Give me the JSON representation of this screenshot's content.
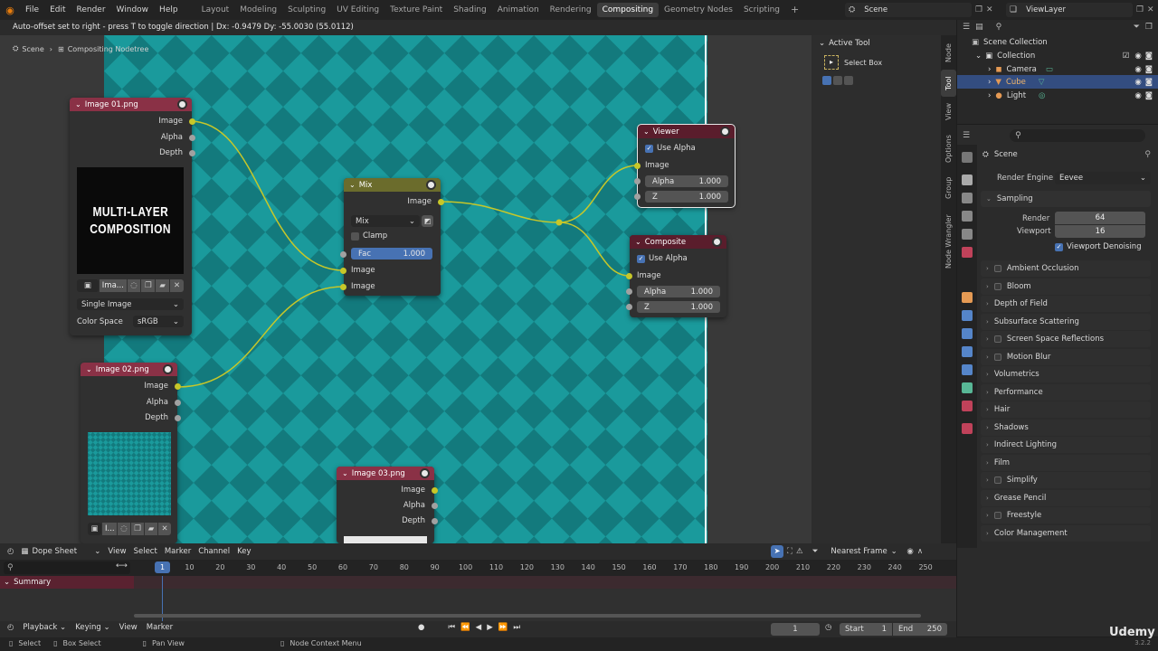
{
  "menus": [
    "File",
    "Edit",
    "Render",
    "Window",
    "Help"
  ],
  "workspaces": [
    "Layout",
    "Modeling",
    "Sculpting",
    "UV Editing",
    "Texture Paint",
    "Shading",
    "Animation",
    "Rendering",
    "Compositing",
    "Geometry Nodes",
    "Scripting"
  ],
  "active_workspace": "Compositing",
  "add_workspace": "+",
  "scene_name": "Scene",
  "view_layer": "ViewLayer",
  "status_header": "Auto-offset set to right - press T to toggle direction  |  Dx: -0.9479   Dy: -55.0030 (55.0112)",
  "breadcrumb": {
    "scene": "Scene",
    "tree": "Compositing Nodetree"
  },
  "nodes": {
    "image1": {
      "title": "Image 01.png",
      "outputs": [
        "Image",
        "Alpha",
        "Depth"
      ],
      "preview_line1": "MULTI-LAYER",
      "preview_line2": "COMPOSITION",
      "file_label": "Ima...",
      "source": "Single Image",
      "colorspace_label": "Color Space",
      "colorspace_value": "sRGB"
    },
    "image2": {
      "title": "Image 02.png",
      "outputs": [
        "Image",
        "Alpha",
        "Depth"
      ],
      "file_label": "I..."
    },
    "image3": {
      "title": "Image 03.png",
      "outputs": [
        "Image",
        "Alpha",
        "Depth"
      ]
    },
    "mix": {
      "title": "Mix",
      "output": "Image",
      "blend": "Mix",
      "clamp": "Clamp",
      "fac_label": "Fac",
      "fac_value": "1.000",
      "inputs": [
        "Image",
        "Image"
      ]
    },
    "viewer": {
      "title": "Viewer",
      "use_alpha": "Use Alpha",
      "input": "Image",
      "alpha_label": "Alpha",
      "alpha_value": "1.000",
      "z_label": "Z",
      "z_value": "1.000"
    },
    "composite": {
      "title": "Composite",
      "use_alpha": "Use Alpha",
      "input": "Image",
      "alpha_label": "Alpha",
      "alpha_value": "1.000",
      "z_label": "Z",
      "z_value": "1.000"
    }
  },
  "npanel": {
    "header": "Active Tool",
    "tool": "Select Box",
    "tabs": [
      "Node",
      "Tool",
      "View",
      "Options",
      "Group",
      "Node Wrangler"
    ],
    "active_tab": "Tool"
  },
  "outliner": {
    "root": "Scene Collection",
    "collection": "Collection",
    "items": [
      "Camera",
      "Cube",
      "Light"
    ],
    "selected": "Cube"
  },
  "properties": {
    "scene": "Scene",
    "render_engine_label": "Render Engine",
    "render_engine": "Eevee",
    "sampling": "Sampling",
    "render_label": "Render",
    "render_value": "64",
    "viewport_label": "Viewport",
    "viewport_value": "16",
    "viewport_denoising": "Viewport Denoising",
    "panels": [
      {
        "label": "Ambient Occlusion",
        "checkbox": true
      },
      {
        "label": "Bloom",
        "checkbox": true
      },
      {
        "label": "Depth of Field",
        "checkbox": false
      },
      {
        "label": "Subsurface Scattering",
        "checkbox": false
      },
      {
        "label": "Screen Space Reflections",
        "checkbox": true
      },
      {
        "label": "Motion Blur",
        "checkbox": true
      },
      {
        "label": "Volumetrics",
        "checkbox": false
      },
      {
        "label": "Performance",
        "checkbox": false
      },
      {
        "label": "Hair",
        "checkbox": false
      },
      {
        "label": "Shadows",
        "checkbox": false
      },
      {
        "label": "Indirect Lighting",
        "checkbox": false
      },
      {
        "label": "Film",
        "checkbox": false
      },
      {
        "label": "Simplify",
        "checkbox": true
      },
      {
        "label": "Grease Pencil",
        "checkbox": false
      },
      {
        "label": "Freestyle",
        "checkbox": true
      },
      {
        "label": "Color Management",
        "checkbox": false
      }
    ]
  },
  "timeline": {
    "editor": "Dope Sheet",
    "menus": [
      "View",
      "Select",
      "Marker",
      "Channel",
      "Key"
    ],
    "interpolation": "Nearest Frame",
    "summary": "Summary",
    "current_frame_badge": "1",
    "ticks": [
      "10",
      "20",
      "30",
      "40",
      "50",
      "60",
      "70",
      "80",
      "90",
      "100",
      "110",
      "120",
      "130",
      "140",
      "150",
      "160",
      "170",
      "180",
      "190",
      "200",
      "210",
      "220",
      "230",
      "240",
      "250"
    ],
    "playback": "Playback",
    "keying": "Keying",
    "view": "View",
    "marker": "Marker",
    "current_frame": "1",
    "start_label": "Start",
    "start": "1",
    "end_label": "End",
    "end": "250"
  },
  "statusbar": {
    "select": "Select",
    "box_select": "Box Select",
    "pan": "Pan View",
    "context": "Node Context Menu",
    "version": "3.2.2"
  },
  "watermark": "Udemy",
  "colors": {
    "image_node_header": "#8a3146",
    "mix_node_header": "#6b6c2c",
    "output_node_header": "#5a1d2c",
    "link": "#c7c729",
    "backdrop_a": "#1a9a9c",
    "backdrop_b": "#137a7d",
    "accent": "#4772b3"
  }
}
